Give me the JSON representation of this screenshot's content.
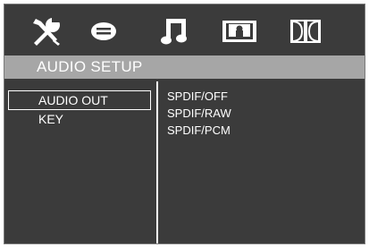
{
  "tabs": [
    {
      "icon": "tools-icon",
      "name": "general-setup"
    },
    {
      "icon": "speech-bubble-icon",
      "name": "language-setup"
    },
    {
      "icon": "music-note-icon",
      "name": "audio-setup"
    },
    {
      "icon": "tv-icon",
      "name": "video-setup"
    },
    {
      "icon": "dolby-icon",
      "name": "dolby-setup"
    }
  ],
  "active_tab": "audio-setup",
  "header": {
    "title": "AUDIO SETUP"
  },
  "menu": {
    "items": [
      {
        "label": "AUDIO OUT",
        "selected": true
      },
      {
        "label": "KEY",
        "selected": false
      }
    ]
  },
  "options": {
    "items": [
      {
        "label": "SPDIF/OFF"
      },
      {
        "label": "SPDIF/RAW"
      },
      {
        "label": "SPDIF/PCM"
      }
    ]
  },
  "colors": {
    "background": "#3b3b3b",
    "title_bar": "#a6a6a6",
    "text": "#ffffff"
  }
}
